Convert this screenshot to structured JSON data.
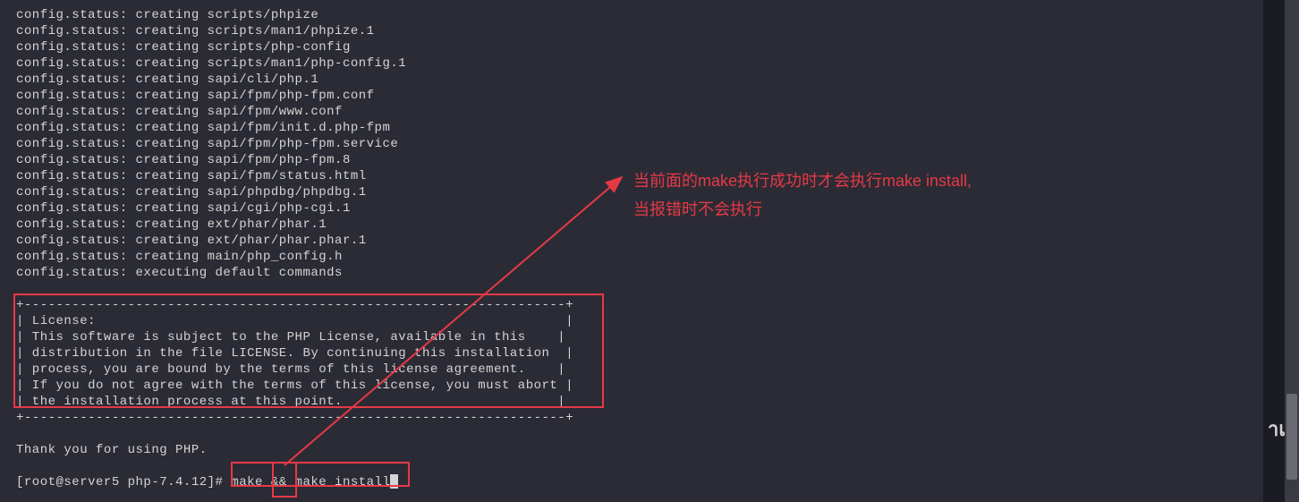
{
  "terminal_lines": [
    "config.status: creating scripts/phpize",
    "config.status: creating scripts/man1/phpize.1",
    "config.status: creating scripts/php-config",
    "config.status: creating scripts/man1/php-config.1",
    "config.status: creating sapi/cli/php.1",
    "config.status: creating sapi/fpm/php-fpm.conf",
    "config.status: creating sapi/fpm/www.conf",
    "config.status: creating sapi/fpm/init.d.php-fpm",
    "config.status: creating sapi/fpm/php-fpm.service",
    "config.status: creating sapi/fpm/php-fpm.8",
    "config.status: creating sapi/fpm/status.html",
    "config.status: creating sapi/phpdbg/phpdbg.1",
    "config.status: creating sapi/cgi/php-cgi.1",
    "config.status: creating ext/phar/phar.1",
    "config.status: creating ext/phar/phar.phar.1",
    "config.status: creating main/php_config.h",
    "config.status: executing default commands",
    "",
    "+--------------------------------------------------------------------+",
    "| License:                                                           |",
    "| This software is subject to the PHP License, available in this    |",
    "| distribution in the file LICENSE. By continuing this installation  |",
    "| process, you are bound by the terms of this license agreement.    |",
    "| If you do not agree with the terms of this license, you must abort |",
    "| the installation process at this point.                           |",
    "+--------------------------------------------------------------------+",
    "",
    "Thank you for using PHP.",
    ""
  ],
  "prompt": {
    "text": "[root@server5 php-7.4.12]# ",
    "command": "make && make install"
  },
  "annotation": {
    "line1": "当前面的make执行成功时才会执行make install,",
    "line2": "当报错时不会执行"
  },
  "right_edge_text": "าเ"
}
